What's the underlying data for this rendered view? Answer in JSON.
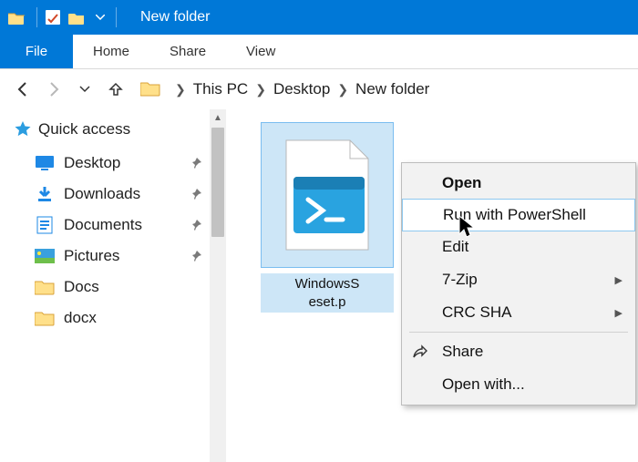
{
  "titlebar": {
    "title": "New folder"
  },
  "ribbon": {
    "file": "File",
    "tabs": [
      "Home",
      "Share",
      "View"
    ]
  },
  "breadcrumbs": [
    "This PC",
    "Desktop",
    "New folder"
  ],
  "sidebar": {
    "quick_access": "Quick access",
    "items": [
      {
        "label": "Desktop",
        "pinned": true
      },
      {
        "label": "Downloads",
        "pinned": true
      },
      {
        "label": "Documents",
        "pinned": true
      },
      {
        "label": "Pictures",
        "pinned": true
      },
      {
        "label": "Docs",
        "pinned": false
      },
      {
        "label": "docx",
        "pinned": false
      }
    ]
  },
  "file": {
    "name_line1": "WindowsS",
    "name_line2": "eset.p"
  },
  "context_menu": {
    "items": [
      {
        "label": "Open",
        "bold": true
      },
      {
        "label": "Run with PowerShell",
        "hover": true
      },
      {
        "label": "Edit"
      },
      {
        "label": "7-Zip",
        "submenu": true
      },
      {
        "label": "CRC SHA",
        "submenu": true
      },
      {
        "label": "Share",
        "icon": "share"
      },
      {
        "label": "Open with..."
      }
    ]
  }
}
